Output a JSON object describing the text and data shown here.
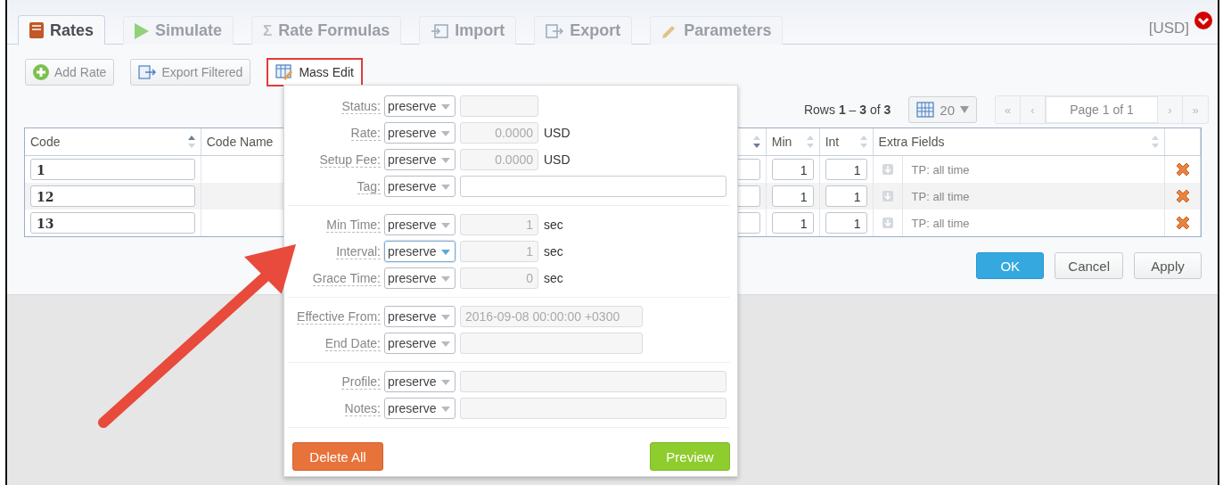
{
  "tabs": [
    {
      "label": "Rates",
      "selected": true
    },
    {
      "label": "Simulate",
      "selected": false
    },
    {
      "label": "Rate Formulas",
      "glyph": "Σ",
      "selected": false
    },
    {
      "label": "Import",
      "selected": false
    },
    {
      "label": "Export",
      "selected": false
    },
    {
      "label": "Parameters",
      "selected": false
    }
  ],
  "currency": "[USD]",
  "toolbar": [
    {
      "label": "Add Rate",
      "highlighted": false
    },
    {
      "label": "Export Filtered",
      "highlighted": false
    },
    {
      "label": "Mass Edit",
      "highlighted": true
    }
  ],
  "rows_info": "Rows **1** – **3** of **3**",
  "per_page": "20",
  "pager": {
    "first": "«",
    "prev": "‹",
    "page": "Page 1 of 1",
    "next": "›",
    "last": "»"
  },
  "table": {
    "columns": [
      {
        "label": "Code",
        "sort_up": true,
        "sort_down": false
      },
      {
        "label": "Code Name"
      },
      {
        "sort_up": false,
        "sort_down": true
      },
      {
        "label": "Min",
        "sort_up": false,
        "sort_down": false
      },
      {
        "label": "Int",
        "sort_up": false,
        "sort_down": false
      },
      {
        "label": "Extra Fields",
        "sort_up": false,
        "sort_down": false
      },
      {}
    ],
    "rows": [
      {
        "code": "1",
        "min": "1",
        "int": "1",
        "extra": "TP: all time"
      },
      {
        "code": "12",
        "min": "1",
        "int": "1",
        "extra": "TP: all time"
      },
      {
        "code": "13",
        "min": "1",
        "int": "1",
        "extra": "TP: all time"
      }
    ]
  },
  "actions": [
    {
      "label": "OK",
      "kind": "primary"
    },
    {
      "label": "Cancel",
      "kind": "default"
    },
    {
      "label": "Apply",
      "kind": "default"
    }
  ],
  "mass_edit": {
    "groups": [
      {
        "fields": [
          {
            "label": "Status:",
            "select": "preserve",
            "kind": "short",
            "disabled": true,
            "focused": false
          },
          {
            "label": "Rate:",
            "select": "preserve",
            "kind": "short",
            "value": "0.0000",
            "unit": "USD",
            "disabled": true,
            "focused": false
          },
          {
            "label": "Setup Fee:",
            "select": "preserve",
            "kind": "short",
            "value": "0.0000",
            "unit": "USD",
            "disabled": true,
            "focused": false
          },
          {
            "label": "Tag:",
            "select": "preserve",
            "kind": "long",
            "disabled": false,
            "focused": false
          }
        ]
      },
      {
        "fields": [
          {
            "label": "Min Time:",
            "select": "preserve",
            "kind": "short",
            "value": "1",
            "unit": "sec",
            "disabled": true,
            "focused": false
          },
          {
            "label": "Interval:",
            "select": "preserve",
            "kind": "short",
            "value": "1",
            "unit": "sec",
            "disabled": true,
            "focused": true
          },
          {
            "label": "Grace Time:",
            "select": "preserve",
            "kind": "short",
            "value": "0",
            "unit": "sec",
            "disabled": true,
            "focused": false
          }
        ]
      },
      {
        "fields": [
          {
            "label": "Effective From:",
            "select": "preserve",
            "kind": "medium",
            "value": "2016-09-08 00:00:00 +0300",
            "disabled": true,
            "focused": false
          },
          {
            "label": "End Date:",
            "select": "preserve",
            "kind": "medium",
            "disabled": true,
            "focused": false
          }
        ]
      },
      {
        "fields": [
          {
            "label": "Profile:",
            "select": "preserve",
            "kind": "long",
            "disabled": true,
            "focused": false
          },
          {
            "label": "Notes:",
            "select": "preserve",
            "kind": "long",
            "disabled": true,
            "focused": false
          }
        ]
      }
    ],
    "delete_label": "Delete All",
    "preview_label": "Preview"
  }
}
